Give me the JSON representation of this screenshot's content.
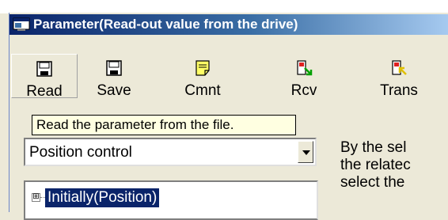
{
  "window": {
    "title": "Parameter(Read-out value from the drive)",
    "title_gradient": [
      "#0a246a",
      "#a6caf0"
    ]
  },
  "toolbar": {
    "buttons": [
      {
        "label": "Read",
        "icon": "floppy-disk-icon"
      },
      {
        "label": "Save",
        "icon": "floppy-disk-icon"
      },
      {
        "label": "Cmnt",
        "icon": "note-icon"
      },
      {
        "label": "Rcv",
        "icon": "receive-icon"
      },
      {
        "label": "Trans",
        "icon": "transmit-icon"
      }
    ]
  },
  "tooltip": {
    "text": "Read the parameter from the file."
  },
  "mode_select": {
    "value": "Position control"
  },
  "tree": {
    "items": [
      {
        "label": "Initially(Position)",
        "expander": "⊞",
        "selected": true
      }
    ]
  },
  "description": {
    "lines": [
      "By the sel",
      "the relatec",
      "select the"
    ]
  }
}
